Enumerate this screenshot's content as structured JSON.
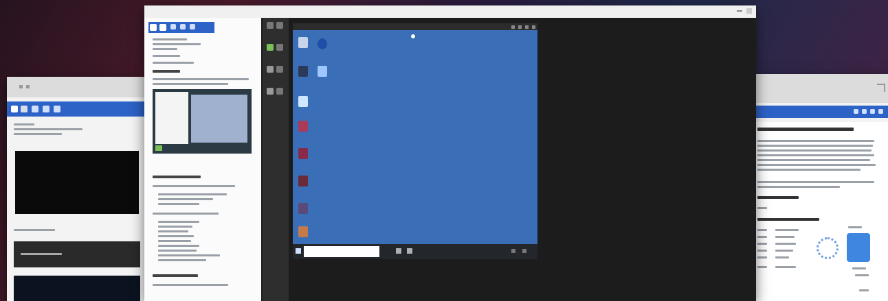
{
  "colors": {
    "accent_blue": "#2d62c6",
    "desktop_blue": "#3a6fb7",
    "vm_dark": "#1c1c1c",
    "toolbar_dark": "#2e2e2e"
  },
  "left_window": {
    "toolbar_icons": [
      "back-icon",
      "forward-icon",
      "home-icon",
      "refresh-icon",
      "star-icon"
    ],
    "side_icons": [
      "pane-icon",
      "bookmark-icon",
      "search-icon",
      "note-icon",
      "tools-icon"
    ]
  },
  "center_window": {
    "sidebar_icons": [
      "pane-icon",
      "bookmark-icon",
      "back-icon",
      "forward-icon",
      "home-icon"
    ],
    "vm_tools": [
      "power-icon",
      "keyboard-icon",
      "clipboard-icon",
      "screen-icon",
      "settings-icon",
      "fullscreen-icon"
    ],
    "desktop_icons": [
      "folder-icon",
      "network-icon",
      "computer-icon",
      "tool-icon",
      "shortcut-icon",
      "app-icon",
      "app-icon",
      "app-icon",
      "app-icon",
      "app-icon"
    ]
  },
  "right_window": {
    "icons": [
      "expand-icon",
      "ctrl-icon",
      "ctrl-icon",
      "ctrl-icon",
      "ctrl-icon",
      "ctrl-icon"
    ]
  }
}
